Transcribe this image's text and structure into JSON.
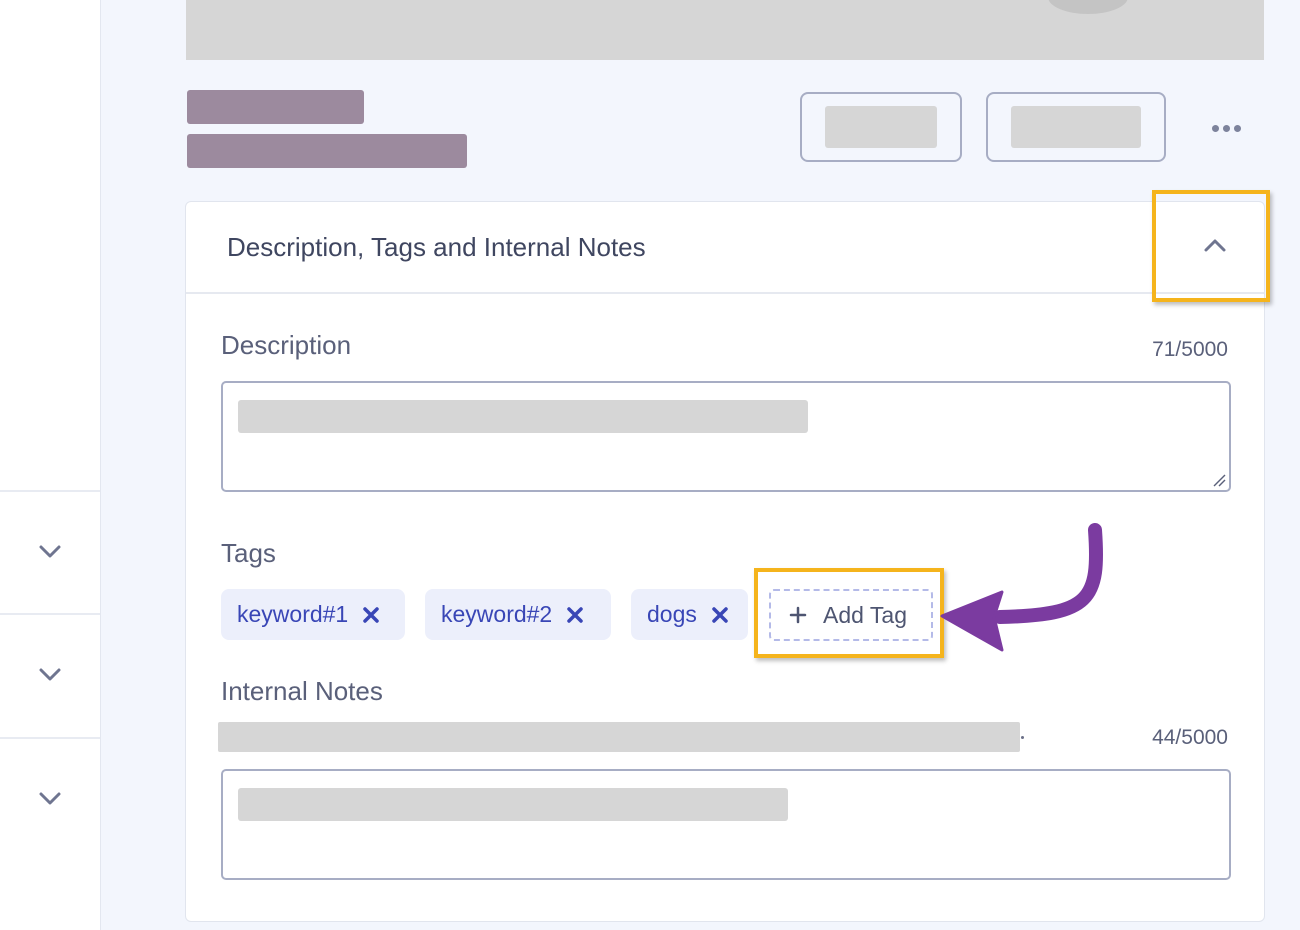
{
  "sidebar": {
    "rows": [
      {
        "icon": "chevron-down-icon"
      },
      {
        "icon": "chevron-down-icon"
      },
      {
        "icon": "chevron-down-icon"
      }
    ]
  },
  "header": {
    "more_icon": "more-horizontal-icon"
  },
  "section": {
    "title": "Description, Tags and Internal Notes",
    "collapse_icon": "chevron-up-icon",
    "description": {
      "label": "Description",
      "counter": "71/5000"
    },
    "tags": {
      "label": "Tags",
      "items": [
        {
          "label": "keyword#1"
        },
        {
          "label": "keyword#2"
        },
        {
          "label": "dogs"
        }
      ],
      "add_label": "Add Tag"
    },
    "internal_notes": {
      "label": "Internal Notes",
      "counter": "44/5000"
    }
  },
  "colors": {
    "highlight": "#f5b41c",
    "arrow": "#7b3ba0",
    "tag_text": "#3946b6",
    "tag_bg": "#eceffb"
  }
}
